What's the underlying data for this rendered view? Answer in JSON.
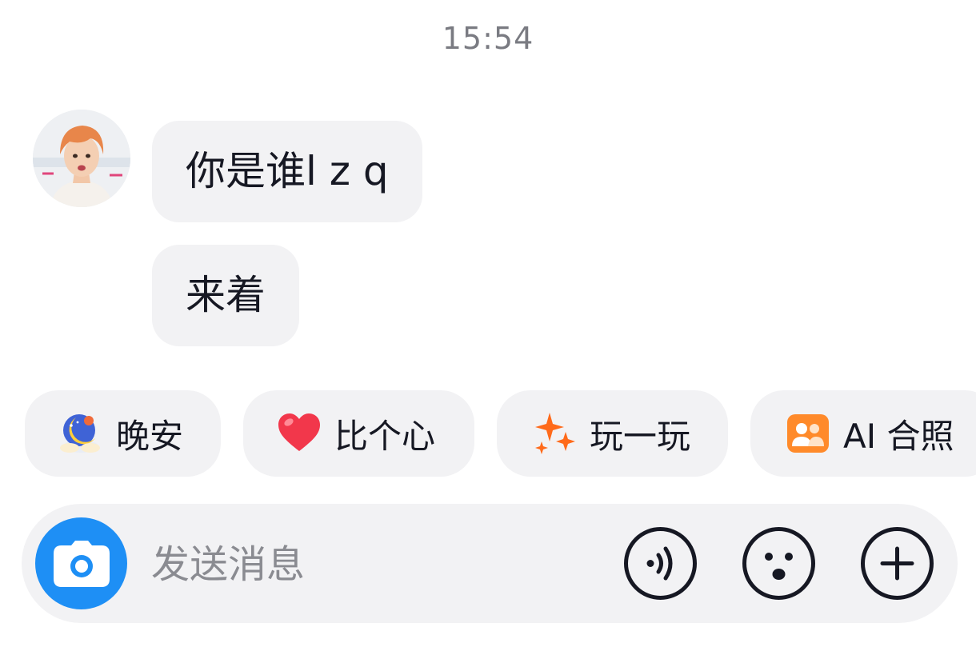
{
  "chat": {
    "timestamp": "15:54",
    "messages": [
      {
        "sender": "other",
        "text": "你是谁l z q"
      },
      {
        "sender": "other",
        "text": "来着"
      }
    ]
  },
  "quick_replies": [
    {
      "label": "晚安",
      "icon": "moon-sleep-icon"
    },
    {
      "label": "比个心",
      "icon": "heart-icon"
    },
    {
      "label": "玩一玩",
      "icon": "sparkle-icon"
    },
    {
      "label": "AI 合照",
      "icon": "ai-photo-icon"
    }
  ],
  "composer": {
    "placeholder": "发送消息",
    "value": "",
    "icons": [
      "camera-icon",
      "voice-icon",
      "emoji-icon",
      "plus-icon"
    ]
  },
  "colors": {
    "bubble_bg": "#f2f2f4",
    "camera_blue": "#1e8ff5",
    "heart_red": "#f2374b",
    "sparkle_orange": "#ff6a1a",
    "ai_orange": "#ff8a2a"
  }
}
